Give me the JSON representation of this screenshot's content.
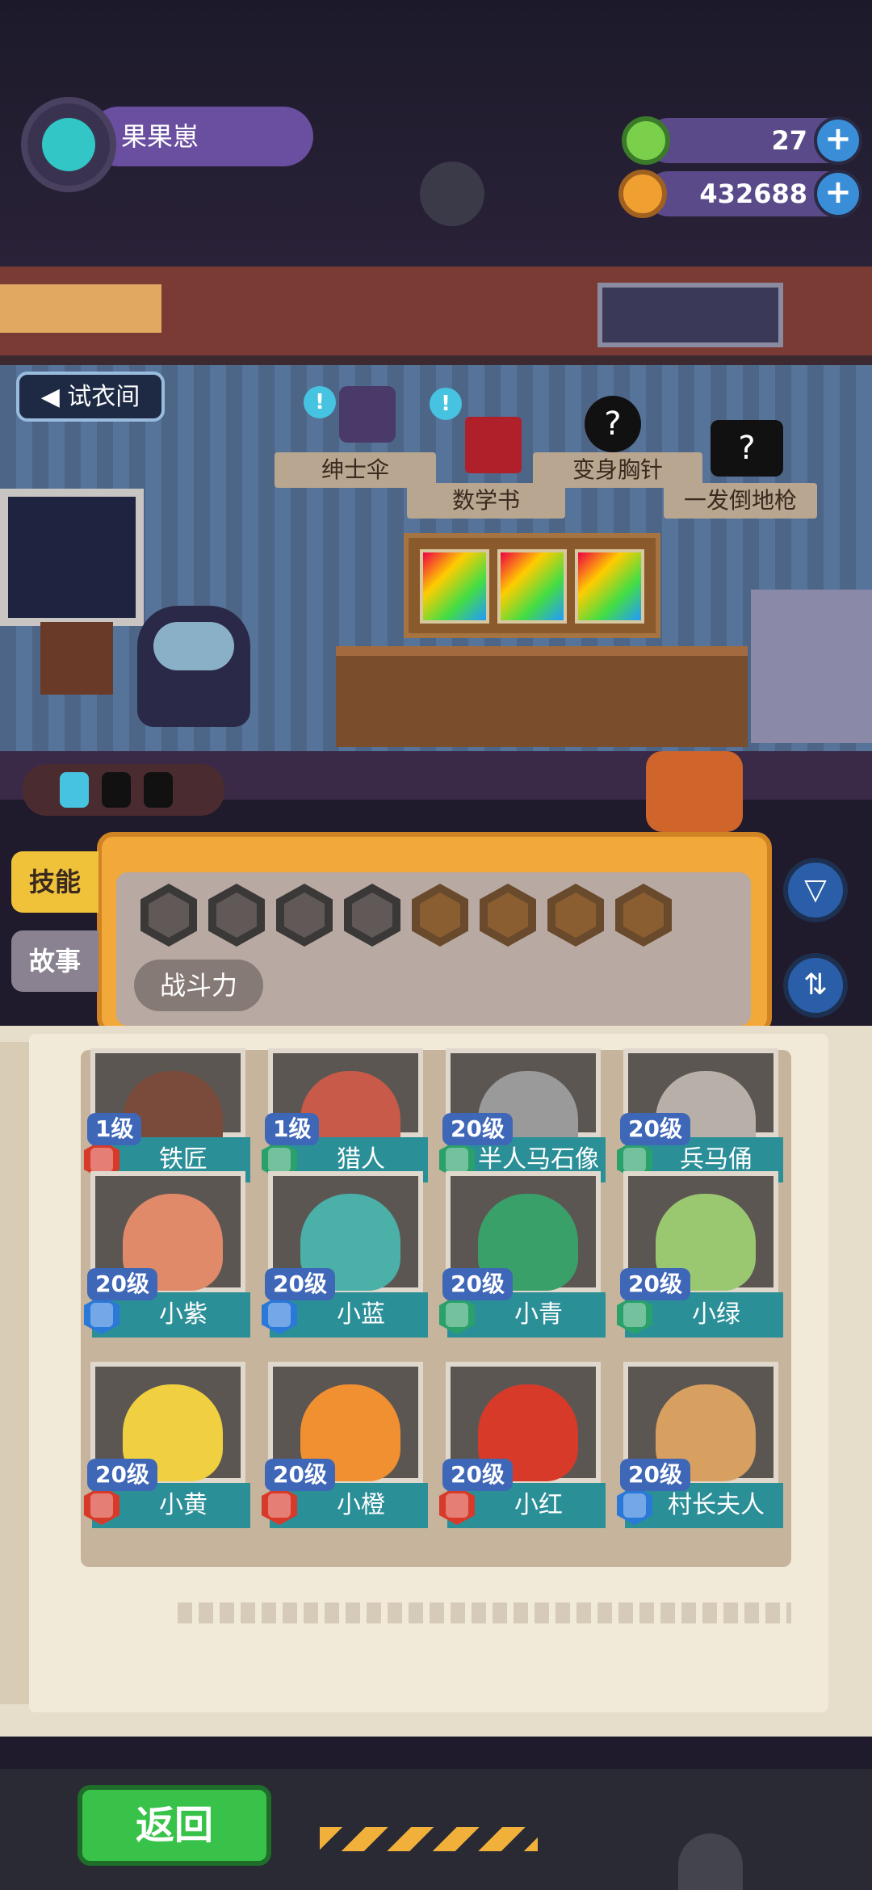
{
  "player": {
    "name": "果果崽"
  },
  "currency": [
    {
      "name": "donut-currency",
      "value": "27",
      "color": "#7ad04a"
    },
    {
      "name": "coin-currency",
      "value": "432688",
      "color": "#f0a030"
    }
  ],
  "room": {
    "fitting_room": "试衣间",
    "items": [
      {
        "label": "绅士伞",
        "icon": "umbrella-icon"
      },
      {
        "label": "数学书",
        "icon": "book-icon"
      },
      {
        "label": "变身胸针",
        "icon": "mystery-icon"
      },
      {
        "label": "一发倒地枪",
        "icon": "mystery-gun-icon"
      }
    ],
    "bubble": "!"
  },
  "tabs": {
    "skill": "技能",
    "story": "故事"
  },
  "filter": {
    "sort_label": "战斗力",
    "filter_icon": "funnel-icon",
    "sort_icon": "sort-icon"
  },
  "cards": [
    {
      "level": "1级",
      "name": "铁匠",
      "class_color": "#d83a2a",
      "face": "#7a4a3a"
    },
    {
      "level": "1级",
      "name": "猎人",
      "class_color": "#2aa06a",
      "face": "#c85a4a"
    },
    {
      "level": "20级",
      "name": "半人马石像",
      "class_color": "#2aa06a",
      "face": "#9a9a9a"
    },
    {
      "level": "20级",
      "name": "兵马俑",
      "class_color": "#2aa06a",
      "face": "#b8b0a8"
    },
    {
      "level": "20级",
      "name": "小紫",
      "class_color": "#2a78d8",
      "face": "#e08a6a"
    },
    {
      "level": "20级",
      "name": "小蓝",
      "class_color": "#2a78d8",
      "face": "#4ab0a8"
    },
    {
      "level": "20级",
      "name": "小青",
      "class_color": "#2aa06a",
      "face": "#3aa06a"
    },
    {
      "level": "20级",
      "name": "小绿",
      "class_color": "#2aa06a",
      "face": "#9ac870"
    },
    {
      "level": "20级",
      "name": "小黄",
      "class_color": "#d83a2a",
      "face": "#f0d040"
    },
    {
      "level": "20级",
      "name": "小橙",
      "class_color": "#d83a2a",
      "face": "#f09030"
    },
    {
      "level": "20级",
      "name": "小红",
      "class_color": "#d83a2a",
      "face": "#d83a2a"
    },
    {
      "level": "20级",
      "name": "村长夫人",
      "class_color": "#2a78d8",
      "face": "#d8a060"
    }
  ],
  "bottom": {
    "back": "返回"
  }
}
